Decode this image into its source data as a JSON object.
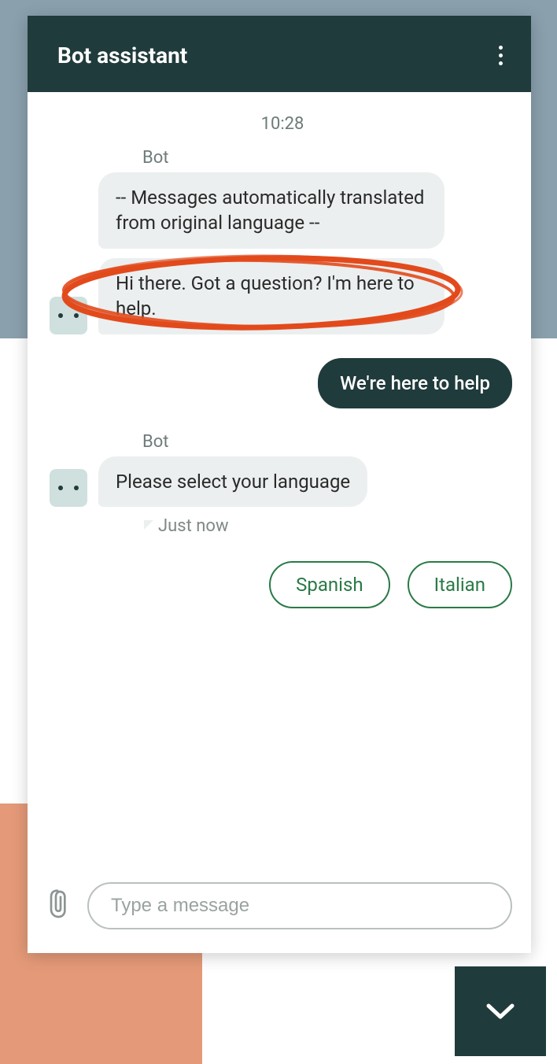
{
  "header": {
    "title": "Bot assistant"
  },
  "conversation": {
    "centerTimestamp": "10:28",
    "senderBot": "Bot",
    "messages": {
      "systemTranslation": "-- Messages automatically translated from original language --",
      "botGreeting": "Hi there. Got a question? I'm here to help.",
      "userReply": "We're here to help",
      "botPrompt": "Please select your language"
    },
    "smallTimestamp": "Just now",
    "languageOptions": {
      "option1": "Spanish",
      "option2": "Italian"
    }
  },
  "composer": {
    "placeholder": "Type a message"
  },
  "icons": {
    "more": "more-vertical-icon",
    "attach": "paperclip-icon",
    "chevron": "chevron-down-icon",
    "botAvatar": "bot-avatar-icon"
  },
  "colors": {
    "brandDark": "#203b3b",
    "bubbleBot": "#ecefef",
    "optionBorder": "#2a7a46",
    "annotation": "#e24a1c"
  }
}
